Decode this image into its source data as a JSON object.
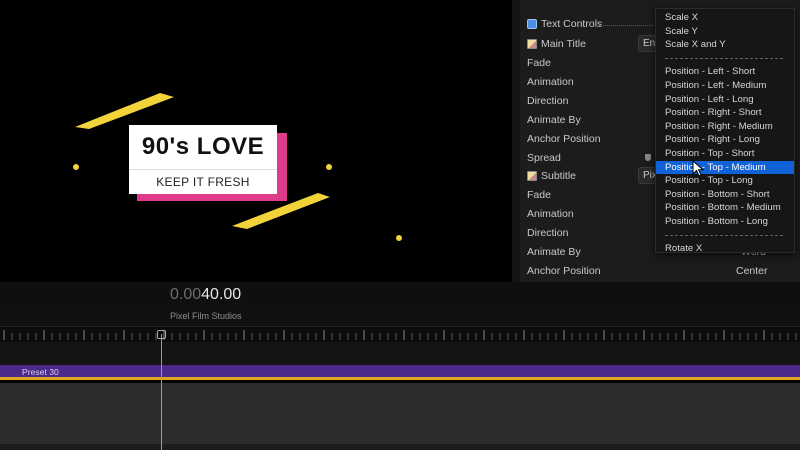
{
  "viewer": {
    "title_main": "90's LOVE",
    "title_sub": "KEEP IT FRESH"
  },
  "inspector": {
    "section_header": "Text Controls",
    "params": [
      {
        "label": "Main Title",
        "kind": "group"
      },
      {
        "label": "Fade"
      },
      {
        "label": "Animation"
      },
      {
        "label": "Direction"
      },
      {
        "label": "Animate By"
      },
      {
        "label": "Anchor Position"
      },
      {
        "label": "Spread"
      },
      {
        "label": "Subtitle",
        "kind": "group"
      },
      {
        "label": "Fade"
      },
      {
        "label": "Animation"
      },
      {
        "label": "Direction"
      },
      {
        "label": "Animate By",
        "value": "Word"
      },
      {
        "label": "Anchor Position",
        "value": "Center"
      }
    ],
    "main_title_value_stub": "En",
    "subtitle_value_stub": "Pix"
  },
  "menu": {
    "items": [
      "Scale X",
      "Scale Y",
      "Scale X and Y",
      "---",
      "Position - Left - Short",
      "Position - Left - Medium",
      "Position - Left - Long",
      "Position - Right - Short",
      "Position - Right - Medium",
      "Position - Right - Long",
      "Position - Top - Short",
      "Position - Top - Medium",
      "Position - Top - Long",
      "Position - Bottom - Short",
      "Position - Bottom - Medium",
      "Position - Bottom - Long",
      "---",
      "Rotate X"
    ],
    "selected": "Position - Top - Medium"
  },
  "timeline": {
    "timecode_dim": "0.00",
    "timecode_main": "40.00",
    "project_name": "Pixel Film Studios",
    "clip_label": "Preset 30"
  },
  "colors": {
    "accent_pink": "#e03a8a",
    "accent_yellow": "#f2d33a",
    "menu_highlight": "#1062d6",
    "clip_purple": "#4b2a8a",
    "clip_border": "#e0a81e"
  },
  "icons": {
    "checkbox": "checkbox-checked-icon",
    "edit": "text-edit-icon",
    "cursor": "mouse-pointer-icon",
    "playhead": "playhead-icon"
  }
}
